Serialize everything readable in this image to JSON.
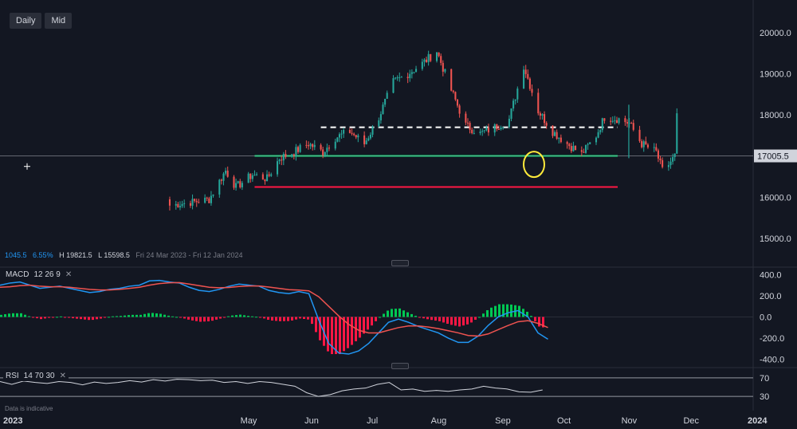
{
  "timeframes": [
    "Daily",
    "Mid"
  ],
  "stats": {
    "change": "1045.5",
    "change_pct": "6.55%",
    "high": "H 19821.5",
    "low": "L 15598.5",
    "range": "Fri 24 Mar 2023 - Fri 12 Jan 2024"
  },
  "macd_label": {
    "name": "MACD",
    "params": "12  26  9",
    "close": "✕"
  },
  "rsi_label": {
    "name": "RSI",
    "params": "14  70  30",
    "close": "✕"
  },
  "disclaimer": "Data is indicative",
  "colors": {
    "bg": "#131722",
    "up": "#26a69a",
    "down": "#ef5350",
    "macd": "#2196f3",
    "signal": "#ef5350",
    "level": "#ffffff",
    "support": "#00e676",
    "lower": "#ff1744",
    "highlight": "#ffeb3b"
  },
  "chart_data": [
    {
      "type": "candlestick",
      "x_ticks": [
        "2023",
        "May",
        "Jun",
        "Jul",
        "Aug",
        "Sep",
        "Oct",
        "Nov",
        "Dec",
        "2024"
      ],
      "y_ticks": [
        "20000.0",
        "19000.0",
        "18000.0",
        "17000.0",
        "16000.0",
        "15000.0"
      ],
      "ylim": [
        14400,
        20600
      ],
      "last_price": "17005.5",
      "last_price_value": 17005.5,
      "horizontal_lines": [
        {
          "value": 17700,
          "style": "dashed",
          "color": "#ffffff",
          "from": "Jun"
        },
        {
          "value": 17005,
          "style": "solid",
          "color": "#00e676",
          "from": "May"
        },
        {
          "value": 16250,
          "style": "solid",
          "color": "#ff1744",
          "from": "May"
        }
      ],
      "highlight": {
        "date": "late Oct",
        "value": 16800,
        "color": "#ffeb3b"
      },
      "close_path": [
        [
          "2023-04-12",
          15950
        ],
        [
          "2023-04-20",
          16650
        ],
        [
          "2023-04-25",
          16250
        ],
        [
          "2023-05-03",
          16550
        ],
        [
          "2023-05-10",
          16450
        ],
        [
          "2023-05-16",
          16950
        ],
        [
          "2023-05-23",
          17100
        ],
        [
          "2023-05-30",
          17300
        ],
        [
          "2023-06-06",
          17100
        ],
        [
          "2023-06-12",
          17450
        ],
        [
          "2023-06-19",
          17600
        ],
        [
          "2023-06-26",
          17300
        ],
        [
          "2023-07-03",
          17950
        ],
        [
          "2023-07-10",
          18800
        ],
        [
          "2023-07-17",
          19000
        ],
        [
          "2023-07-24",
          19250
        ],
        [
          "2023-07-31",
          19550
        ],
        [
          "2023-08-07",
          18600
        ],
        [
          "2023-08-14",
          17750
        ],
        [
          "2023-08-21",
          17550
        ],
        [
          "2023-08-28",
          17700
        ],
        [
          "2023-09-04",
          17900
        ],
        [
          "2023-09-11",
          19200
        ],
        [
          "2023-09-18",
          18100
        ],
        [
          "2023-09-25",
          17600
        ],
        [
          "2023-10-02",
          17300
        ],
        [
          "2023-10-09",
          17050
        ],
        [
          "2023-10-16",
          17500
        ],
        [
          "2023-10-20",
          17950
        ],
        [
          "2023-10-27",
          17900
        ],
        [
          "2023-11-01",
          17800
        ],
        [
          "2023-11-07",
          17300
        ],
        [
          "2023-11-14",
          17100
        ],
        [
          "2023-11-17",
          16650
        ],
        [
          "2023-11-20",
          16800
        ],
        [
          "2023-11-23",
          17000
        ],
        [
          "2023-11-24",
          17950
        ]
      ]
    },
    {
      "type": "line",
      "name": "MACD",
      "y_ticks": [
        "400.0",
        "200.0",
        "0.0",
        "-200.0",
        "-400.0"
      ],
      "ylim": [
        -470,
        470
      ],
      "macd": [
        [
          0,
          300
        ],
        [
          10,
          320
        ],
        [
          20,
          330
        ],
        [
          30,
          300
        ],
        [
          40,
          270
        ],
        [
          50,
          280
        ],
        [
          60,
          290
        ],
        [
          70,
          270
        ],
        [
          80,
          250
        ],
        [
          90,
          230
        ],
        [
          100,
          240
        ],
        [
          110,
          260
        ],
        [
          120,
          270
        ],
        [
          130,
          290
        ],
        [
          140,
          300
        ],
        [
          150,
          340
        ],
        [
          160,
          345
        ],
        [
          170,
          330
        ],
        [
          180,
          320
        ],
        [
          190,
          280
        ],
        [
          200,
          250
        ],
        [
          210,
          240
        ],
        [
          220,
          260
        ],
        [
          230,
          290
        ],
        [
          240,
          310
        ],
        [
          250,
          300
        ],
        [
          260,
          290
        ],
        [
          270,
          250
        ],
        [
          280,
          230
        ],
        [
          290,
          220
        ],
        [
          300,
          240
        ],
        [
          310,
          220
        ],
        [
          320,
          -30
        ],
        [
          330,
          -250
        ],
        [
          340,
          -340
        ],
        [
          350,
          -350
        ],
        [
          360,
          -320
        ],
        [
          370,
          -250
        ],
        [
          380,
          -150
        ],
        [
          390,
          -50
        ],
        [
          400,
          -20
        ],
        [
          410,
          -50
        ],
        [
          420,
          -90
        ],
        [
          430,
          -120
        ],
        [
          440,
          -150
        ],
        [
          450,
          -200
        ],
        [
          460,
          -240
        ],
        [
          470,
          -240
        ],
        [
          480,
          -180
        ],
        [
          490,
          -80
        ],
        [
          500,
          0
        ],
        [
          510,
          40
        ],
        [
          520,
          60
        ],
        [
          530,
          0
        ],
        [
          540,
          -150
        ],
        [
          550,
          -210
        ]
      ],
      "signal": [
        [
          0,
          280
        ],
        [
          10,
          285
        ],
        [
          20,
          295
        ],
        [
          30,
          300
        ],
        [
          40,
          290
        ],
        [
          50,
          285
        ],
        [
          60,
          285
        ],
        [
          70,
          280
        ],
        [
          80,
          270
        ],
        [
          90,
          260
        ],
        [
          100,
          255
        ],
        [
          110,
          255
        ],
        [
          120,
          260
        ],
        [
          130,
          270
        ],
        [
          140,
          280
        ],
        [
          150,
          300
        ],
        [
          160,
          315
        ],
        [
          170,
          322
        ],
        [
          180,
          324
        ],
        [
          190,
          310
        ],
        [
          200,
          295
        ],
        [
          210,
          280
        ],
        [
          220,
          275
        ],
        [
          230,
          278
        ],
        [
          240,
          288
        ],
        [
          250,
          292
        ],
        [
          260,
          292
        ],
        [
          270,
          282
        ],
        [
          280,
          270
        ],
        [
          290,
          258
        ],
        [
          300,
          254
        ],
        [
          310,
          246
        ],
        [
          320,
          190
        ],
        [
          330,
          100
        ],
        [
          340,
          10
        ],
        [
          350,
          -70
        ],
        [
          360,
          -125
        ],
        [
          370,
          -150
        ],
        [
          380,
          -150
        ],
        [
          390,
          -125
        ],
        [
          400,
          -100
        ],
        [
          410,
          -85
        ],
        [
          420,
          -85
        ],
        [
          430,
          -95
        ],
        [
          440,
          -110
        ],
        [
          450,
          -130
        ],
        [
          460,
          -150
        ],
        [
          470,
          -175
        ],
        [
          480,
          -180
        ],
        [
          490,
          -160
        ],
        [
          500,
          -120
        ],
        [
          510,
          -80
        ],
        [
          520,
          -45
        ],
        [
          530,
          -35
        ],
        [
          540,
          -60
        ],
        [
          550,
          -100
        ]
      ]
    },
    {
      "type": "line",
      "name": "RSI",
      "y_ticks": [
        "70",
        "30"
      ],
      "ylim": [
        20,
        80
      ],
      "rsi": [
        [
          0,
          62
        ],
        [
          10,
          56
        ],
        [
          20,
          63
        ],
        [
          30,
          60
        ],
        [
          40,
          58
        ],
        [
          50,
          62
        ],
        [
          60,
          60
        ],
        [
          70,
          55
        ],
        [
          80,
          61
        ],
        [
          90,
          58
        ],
        [
          100,
          60
        ],
        [
          110,
          64
        ],
        [
          120,
          61
        ],
        [
          130,
          66
        ],
        [
          140,
          63
        ],
        [
          150,
          67
        ],
        [
          160,
          66
        ],
        [
          170,
          64
        ],
        [
          180,
          65
        ],
        [
          190,
          60
        ],
        [
          200,
          62
        ],
        [
          210,
          58
        ],
        [
          220,
          62
        ],
        [
          230,
          60
        ],
        [
          240,
          56
        ],
        [
          250,
          52
        ],
        [
          260,
          38
        ],
        [
          270,
          30
        ],
        [
          280,
          34
        ],
        [
          290,
          42
        ],
        [
          300,
          46
        ],
        [
          310,
          48
        ],
        [
          320,
          56
        ],
        [
          330,
          60
        ],
        [
          340,
          44
        ],
        [
          350,
          46
        ],
        [
          360,
          41
        ],
        [
          370,
          43
        ],
        [
          380,
          41
        ],
        [
          390,
          44
        ],
        [
          400,
          46
        ],
        [
          410,
          52
        ],
        [
          420,
          48
        ],
        [
          430,
          46
        ],
        [
          440,
          40
        ],
        [
          450,
          39
        ],
        [
          460,
          44
        ]
      ]
    }
  ]
}
